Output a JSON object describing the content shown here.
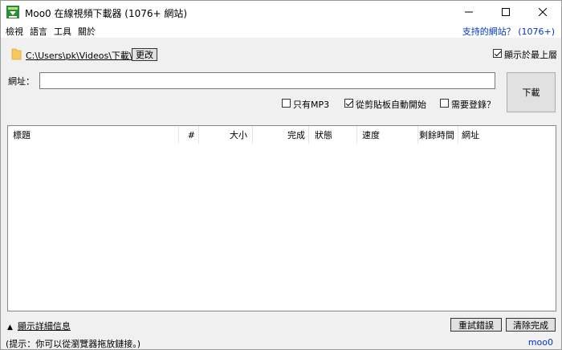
{
  "window": {
    "title": "Moo0 在線視頻下載器 (1076+ 網站)"
  },
  "menu": {
    "items": [
      "檢視",
      "語言",
      "工具",
      "關於"
    ],
    "supported_sites": "支持的網站？ (1076+)"
  },
  "folder": {
    "path": "C:\\Users\\pk\\Videos\\下載\\",
    "change_label": "更改"
  },
  "options": {
    "always_on_top": {
      "label": "顯示於最上層",
      "checked": true
    },
    "mp3_only": {
      "label": "只有MP3",
      "checked": false
    },
    "auto_from_clipboard": {
      "label": "從剪貼板自動開始",
      "checked": true
    },
    "requires_login": {
      "label": "需要登錄？",
      "checked": false
    }
  },
  "url": {
    "label": "網址：",
    "value": "",
    "download_label": "下載"
  },
  "table": {
    "columns": [
      "標題",
      "#",
      "大小",
      "完成",
      "狀態",
      "速度",
      "剩餘時間",
      "網址"
    ],
    "rows": []
  },
  "footer": {
    "details_label": "顯示詳細信息",
    "retry_label": "重試錯誤",
    "clear_label": "清除完成",
    "hint": "(提示：你可以從瀏覽器拖放鏈接。)",
    "brand_link": "moo0"
  }
}
